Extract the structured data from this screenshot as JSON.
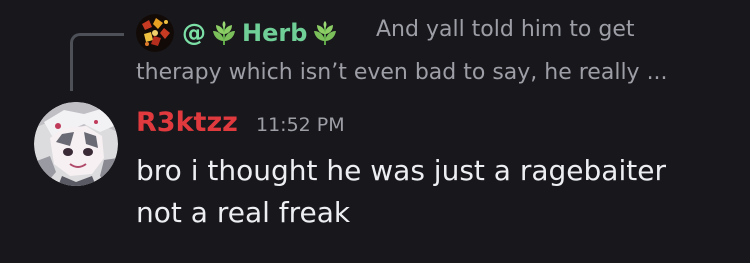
{
  "reply": {
    "author_mention": "@",
    "author_name": "Herb",
    "author_name_color": "#6fcf97",
    "leaf_icon": "herb-leaf-icon",
    "preview_line1": "And yall told him to get",
    "preview_line2": "therapy which isn’t even bad to say, he really ..."
  },
  "message": {
    "author": "R3ktzz",
    "author_color": "#e03a3e",
    "timestamp": "11:52 PM",
    "lines": [
      "bro i thought he was just a ragebaiter",
      "not a real freak"
    ]
  },
  "colors": {
    "background": "#17171c",
    "muted_text": "#9d9ea6",
    "body_text": "#eceef1",
    "spine": "#4e5058"
  }
}
